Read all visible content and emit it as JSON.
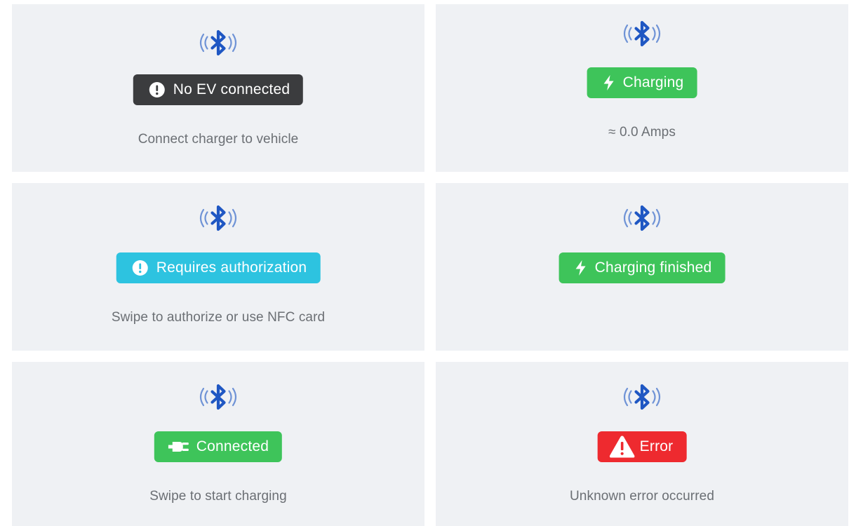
{
  "colors": {
    "card_bg": "#eff1f4",
    "bluetooth_blue": "#1f57c3",
    "status_dark": "#3b3c3e",
    "status_green": "#3ec45a",
    "status_cyan": "#2dc3e0",
    "status_red": "#ee2a2f",
    "subtitle_gray": "#6b6f74"
  },
  "cards": [
    {
      "icon": "bluetooth-signal-icon",
      "status_icon": "exclamation-circle-icon",
      "status_label": "No EV connected",
      "status_color": "#3b3c3e",
      "subtitle": "Connect charger to vehicle"
    },
    {
      "icon": "bluetooth-signal-icon",
      "status_icon": "lightning-bolt-icon",
      "status_label": "Charging",
      "status_color": "#3ec45a",
      "subtitle": "≈ 0.0 Amps"
    },
    {
      "icon": "bluetooth-signal-icon",
      "status_icon": "exclamation-circle-icon",
      "status_label": "Requires authorization",
      "status_color": "#2dc3e0",
      "subtitle": "Swipe to authorize or use NFC card"
    },
    {
      "icon": "bluetooth-signal-icon",
      "status_icon": "lightning-bolt-icon",
      "status_label": "Charging finished",
      "status_color": "#3ec45a",
      "subtitle": ""
    },
    {
      "icon": "bluetooth-signal-icon",
      "status_icon": "plug-icon",
      "status_label": "Connected",
      "status_color": "#3ec45a",
      "subtitle": "Swipe to start charging"
    },
    {
      "icon": "bluetooth-signal-icon",
      "status_icon": "warning-triangle-icon",
      "status_label": "Error",
      "status_color": "#ee2a2f",
      "subtitle": "Unknown error occurred"
    }
  ]
}
